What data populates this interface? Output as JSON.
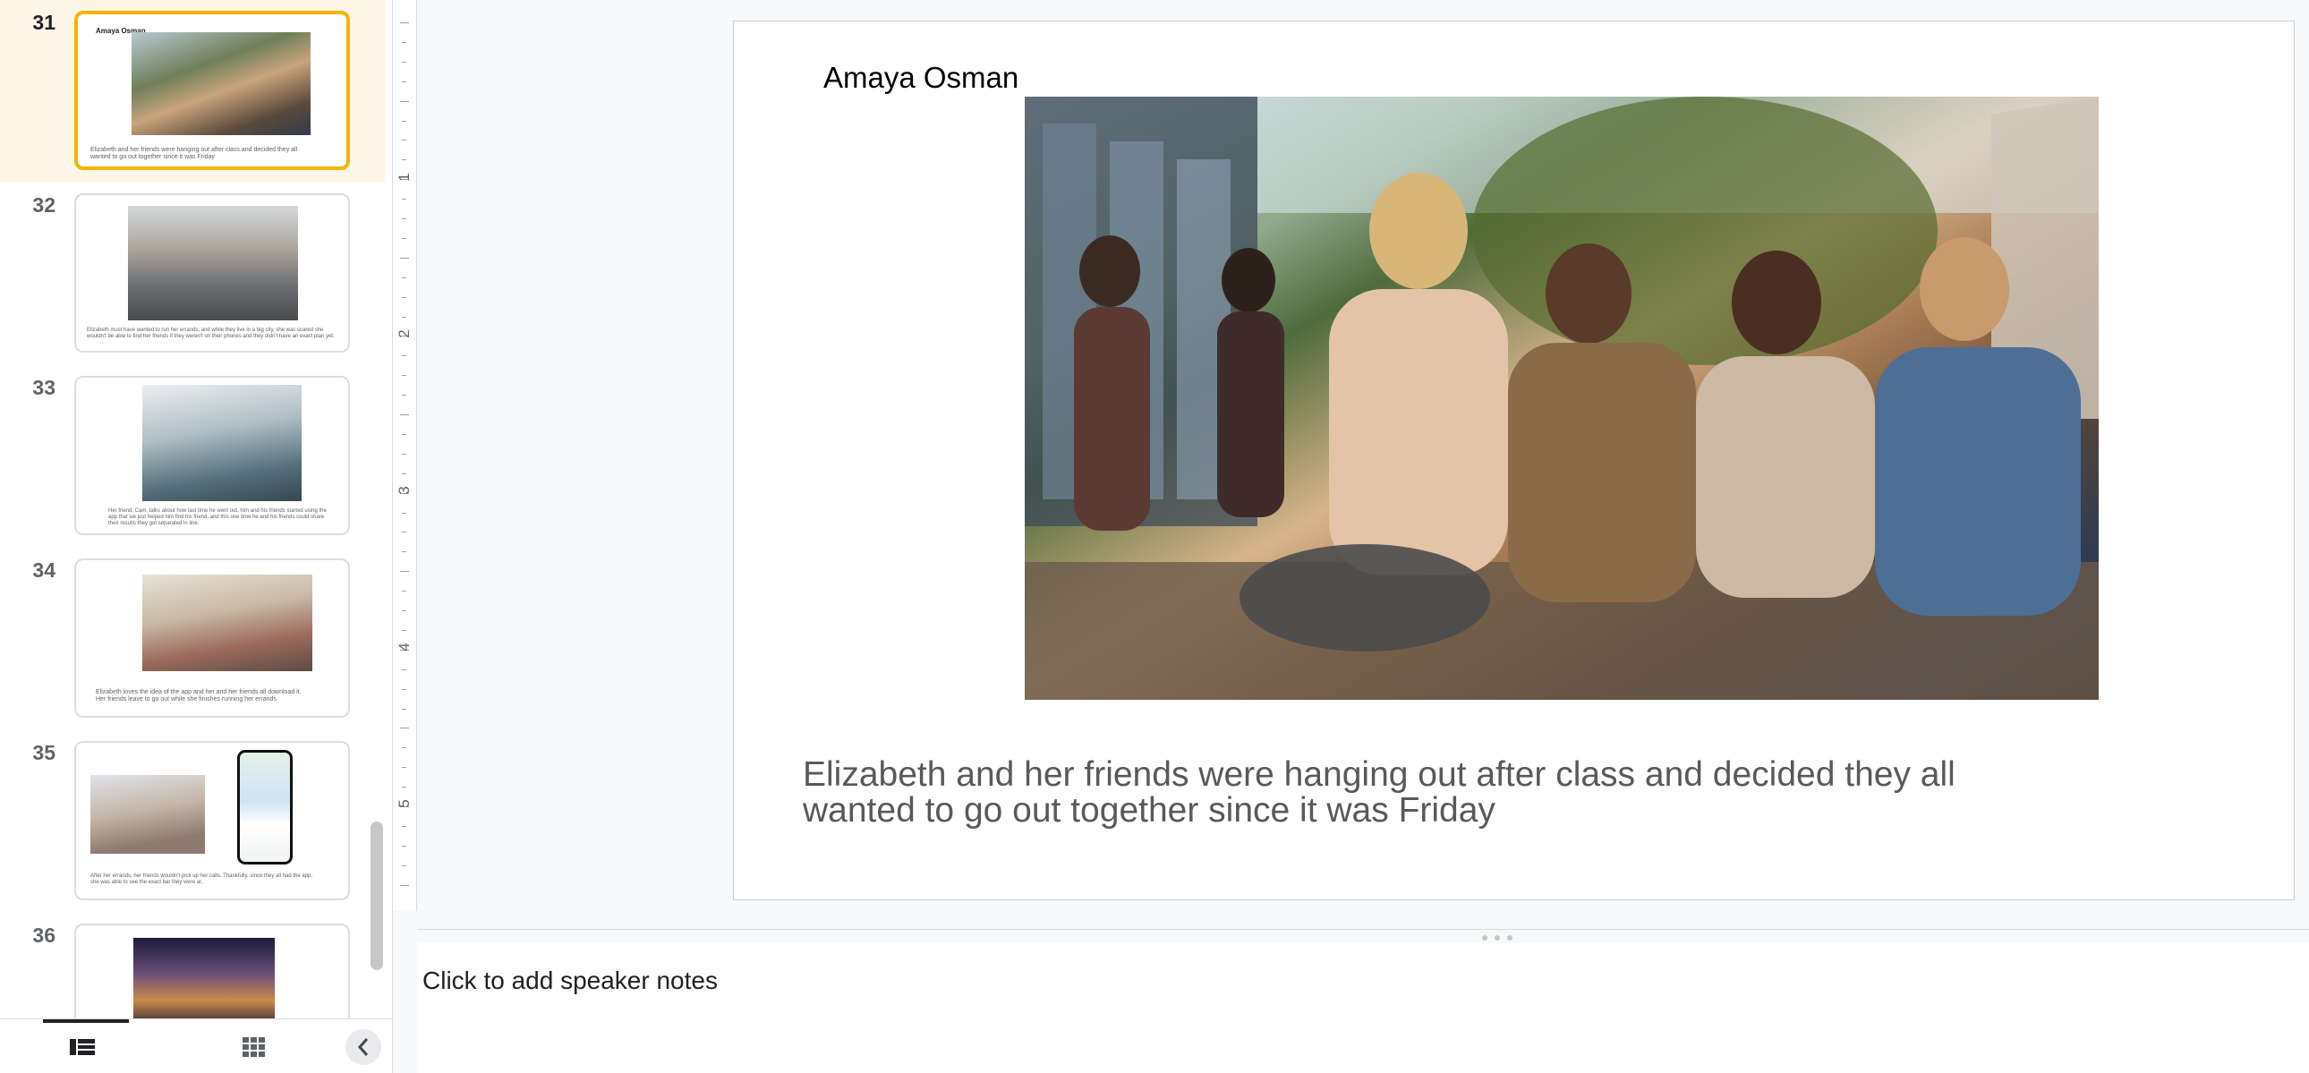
{
  "filmstrip": {
    "slides": [
      {
        "number": "31",
        "title": "Amaya Osman",
        "text": "Elizabeth and her friends were hanging out after class and decided they all wanted to go out together since it was Friday",
        "selected": true
      },
      {
        "number": "32",
        "text": "Elizabeth must have wanted to run her errands, and while they live in a big city, she was scared she wouldn't be able to find her friends if they weren't on their phones and they didn't have an exact plan yet."
      },
      {
        "number": "33",
        "text": "Her friend, Cam, talks about how last time he went out, him and his friends started using the app that we just helped him find his friend, and this one time he and his friends could share their results they got separated in line."
      },
      {
        "number": "34",
        "text": "Elizabeth loves the idea of the app and her and her friends all download it. Her friends leave to go out while she finishes running her errands"
      },
      {
        "number": "35",
        "text": "After her errands, her friends wouldn't pick up her calls. Thankfully, since they all had the app, she was able to see the exact bar they were at."
      },
      {
        "number": "36",
        "text": ""
      }
    ]
  },
  "ruler": {
    "numbers": [
      "1",
      "2",
      "3",
      "4",
      "5"
    ]
  },
  "slide": {
    "title": "Amaya Osman",
    "body": "Elizabeth and her friends were hanging out after class and decided they all wanted to go out together since it was Friday"
  },
  "notes": {
    "placeholder": "Click to add speaker notes"
  },
  "icons": {
    "filmstrip_view": "filmstrip-view-icon",
    "grid_view": "grid-view-icon",
    "collapse": "chevron-left-icon"
  },
  "colors": {
    "selected_border": "#f4b400",
    "selected_background": "#fdf5e6"
  }
}
